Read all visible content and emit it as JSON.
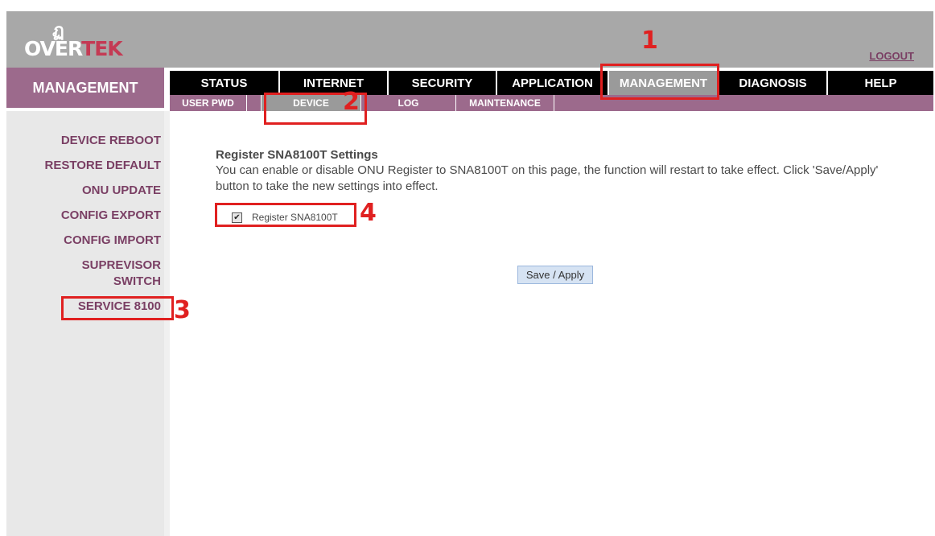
{
  "header": {
    "logo_mark": "ฏ",
    "logo_text_a": "OVER",
    "logo_text_b": "TEK",
    "logout_label": "LOGOUT"
  },
  "section_title": "MANAGEMENT",
  "main_nav": {
    "items": [
      "STATUS",
      "INTERNET",
      "SECURITY",
      "APPLICATION",
      "MANAGEMENT",
      "DIAGNOSIS",
      "HELP"
    ],
    "active": "MANAGEMENT"
  },
  "sub_nav": {
    "items": [
      "USER PWD",
      "DEVICE",
      "LOG",
      "MAINTENANCE"
    ],
    "active": "DEVICE"
  },
  "sidebar": {
    "items": [
      "DEVICE REBOOT",
      "RESTORE DEFAULT",
      "ONU UPDATE",
      "CONFIG EXPORT",
      "CONFIG IMPORT",
      "SUPREVISOR SWITCH",
      "SERVICE 8100"
    ]
  },
  "content": {
    "title": "Register SNA8100T Settings",
    "description": "You can enable or disable ONU Register to SNA8100T on this page, the function will restart to take effect. Click 'Save/Apply' button to take the new settings into effect.",
    "checkbox_label": "Register SNA8100T",
    "checkbox_checked": true,
    "checkbox_glyph": "✔",
    "save_label": "Save / Apply"
  },
  "annotations": {
    "color": "#e02020",
    "labels": [
      "1",
      "2",
      "3",
      "4"
    ]
  }
}
